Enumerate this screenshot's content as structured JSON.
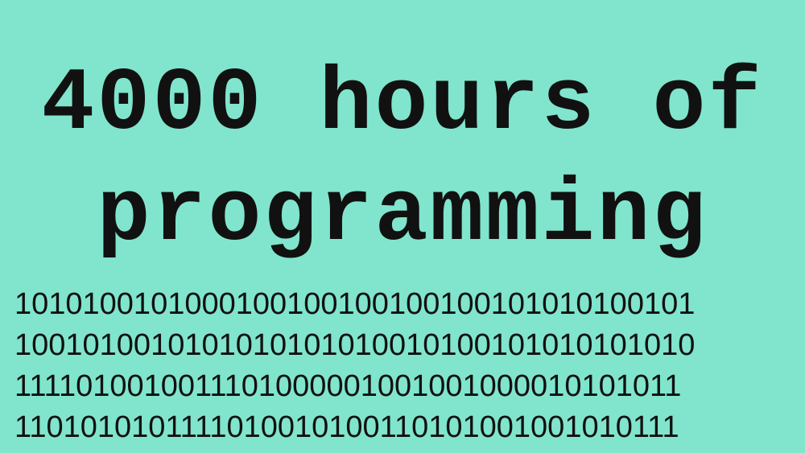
{
  "title": {
    "line1": "4000 hours of",
    "line2": "programming"
  },
  "binary_rows": [
    "1010100101000100100100100100101010100101",
    "1001010010101010101010010100101010101010",
    "1111010010011101000001001001000010101011",
    "1101010101111010010100110101001001010111"
  ]
}
